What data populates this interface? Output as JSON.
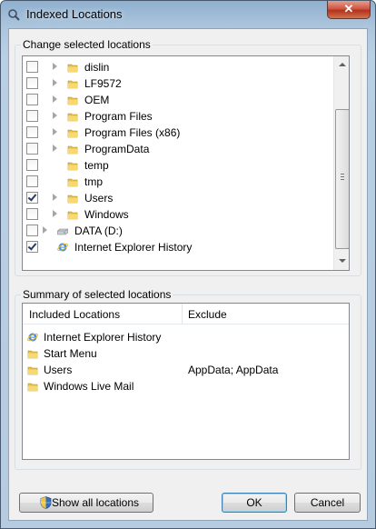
{
  "window": {
    "title": "Indexed Locations",
    "close_glyph": "✕"
  },
  "change_group": {
    "label": "Change selected locations",
    "items": [
      {
        "label": "dislin",
        "checked": false,
        "has_expander": true,
        "icon": "folder-icon",
        "indent": 1
      },
      {
        "label": "LF9572",
        "checked": false,
        "has_expander": true,
        "icon": "folder-icon",
        "indent": 1
      },
      {
        "label": "OEM",
        "checked": false,
        "has_expander": true,
        "icon": "folder-icon",
        "indent": 1
      },
      {
        "label": "Program Files",
        "checked": false,
        "has_expander": true,
        "icon": "folder-icon",
        "indent": 1
      },
      {
        "label": "Program Files (x86)",
        "checked": false,
        "has_expander": true,
        "icon": "folder-icon",
        "indent": 1
      },
      {
        "label": "ProgramData",
        "checked": false,
        "has_expander": true,
        "icon": "folder-icon",
        "indent": 1
      },
      {
        "label": "temp",
        "checked": false,
        "has_expander": false,
        "icon": "folder-icon",
        "indent": 1
      },
      {
        "label": "tmp",
        "checked": false,
        "has_expander": false,
        "icon": "folder-icon",
        "indent": 1
      },
      {
        "label": "Users",
        "checked": true,
        "has_expander": true,
        "icon": "folder-icon",
        "indent": 1
      },
      {
        "label": "Windows",
        "checked": false,
        "has_expander": true,
        "icon": "folder-icon",
        "indent": 1
      },
      {
        "label": "DATA (D:)",
        "checked": false,
        "has_expander": true,
        "icon": "drive-icon",
        "indent": 0
      },
      {
        "label": "Internet Explorer History",
        "checked": true,
        "has_expander": false,
        "icon": "ie-icon",
        "indent": 0
      }
    ]
  },
  "summary_group": {
    "label": "Summary of selected locations",
    "columns": {
      "included": "Included Locations",
      "exclude": "Exclude"
    },
    "rows": [
      {
        "included": "Internet Explorer History",
        "exclude": "",
        "icon": "ie-icon"
      },
      {
        "included": "Start Menu",
        "exclude": "",
        "icon": "folder-icon"
      },
      {
        "included": "Users",
        "exclude": "AppData; AppData",
        "icon": "folder-icon"
      },
      {
        "included": "Windows Live Mail",
        "exclude": "",
        "icon": "folder-icon"
      }
    ]
  },
  "buttons": {
    "show_all": "Show all locations",
    "ok": "OK",
    "cancel": "Cancel"
  },
  "colors": {
    "folder": "#e8c04a",
    "accent": "#3c7fb1",
    "close": "#c7432b"
  }
}
